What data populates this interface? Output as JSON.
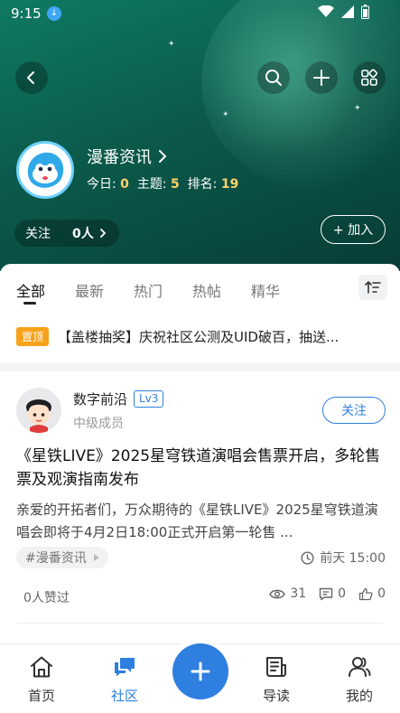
{
  "status_bar": {
    "time": "9:15"
  },
  "group": {
    "name": "漫番资讯",
    "stats": [
      {
        "label": "今日:",
        "value": "0"
      },
      {
        "label": "主题:",
        "value": "5"
      },
      {
        "label": "排名:",
        "value": "19"
      }
    ],
    "follow_label": "关注",
    "follow_count": "0人",
    "join_label": "+ 加入"
  },
  "tabs": [
    {
      "label": "全部",
      "active": true
    },
    {
      "label": "最新",
      "active": false
    },
    {
      "label": "热门",
      "active": false
    },
    {
      "label": "热帖",
      "active": false
    },
    {
      "label": "精华",
      "active": false
    }
  ],
  "pinned": {
    "badge": "置顶",
    "text": "【盖楼抽奖】庆祝社区公测及UID破百，抽送..."
  },
  "post": {
    "author": "数字前沿",
    "level": "Lv3",
    "rank": "中级成员",
    "follow_button": "关注",
    "title": "《星铁LIVE》2025星穹铁道演唱会售票开启，多轮售票及观演指南发布",
    "body": "亲爱的开拓者们，万众期待的《星铁LIVE》2025星穹铁道演唱会即将于4月2日18:00正式开启第一轮售 ...",
    "tag": "#漫番资讯",
    "time": "前天 15:00",
    "likes_text": "0人赞过",
    "views": "31",
    "comments": "0",
    "likes": "0"
  },
  "bottom_nav": [
    {
      "label": "首页",
      "icon": "home-icon",
      "active": false
    },
    {
      "label": "社区",
      "icon": "chat-bubbles-icon",
      "active": true
    },
    {
      "label": "导读",
      "icon": "newspaper-icon",
      "active": false
    },
    {
      "label": "我的",
      "icon": "user-icon",
      "active": false
    }
  ],
  "colors": {
    "accent": "#2f7fe0",
    "header": "#0b5a4c",
    "pin_badge": "#f7a21b",
    "stat_highlight": "#ffd36a"
  }
}
